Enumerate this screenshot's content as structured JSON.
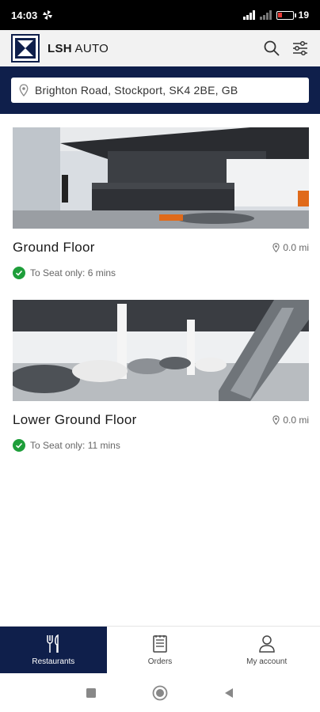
{
  "status_bar": {
    "time": "14:03",
    "battery": "19"
  },
  "header": {
    "brand_bold": "LSH",
    "brand_rest": " AUTO"
  },
  "location": {
    "value": "Brighton Road, Stockport, SK4 2BE, GB"
  },
  "venues": [
    {
      "name": "Ground Floor",
      "distance": "0.0 mi",
      "wait": "To Seat only: 6 mins"
    },
    {
      "name": "Lower Ground Floor",
      "distance": "0.0 mi",
      "wait": "To Seat only: 11 mins"
    }
  ],
  "bottom_nav": {
    "items": [
      {
        "label": "Restaurants",
        "icon": "cutlery-icon",
        "active": true
      },
      {
        "label": "Orders",
        "icon": "receipt-icon",
        "active": false
      },
      {
        "label": "My account",
        "icon": "user-icon",
        "active": false
      }
    ]
  },
  "colors": {
    "primary": "#0f1f4b",
    "success": "#1e9e3a",
    "header_bg": "#f2f2f2"
  }
}
